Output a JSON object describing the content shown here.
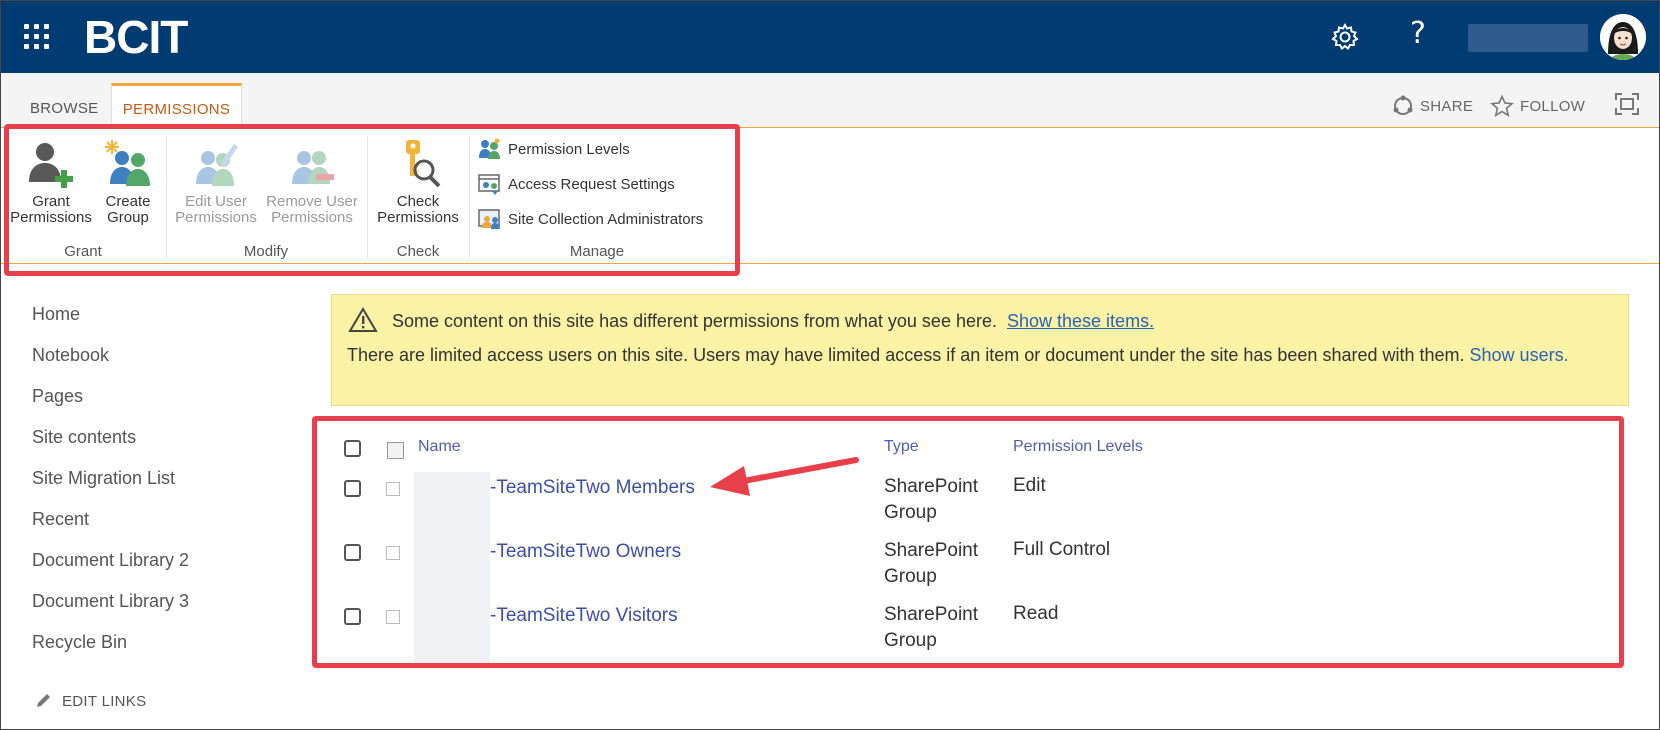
{
  "suite_bar": {
    "brand": "BCIT",
    "help_glyph": "?",
    "icons": [
      "waffle-icon",
      "gear-icon",
      "help-icon",
      "avatar"
    ]
  },
  "ribbon": {
    "tabs": [
      {
        "label": "BROWSE",
        "active": false
      },
      {
        "label": "PERMISSIONS",
        "active": true
      }
    ],
    "share_label": "SHARE",
    "follow_label": "FOLLOW",
    "groups": {
      "grant": {
        "label": "Grant",
        "buttons": [
          {
            "line1": "Grant",
            "line2": "Permissions",
            "icon": "grant-user-icon",
            "enabled": true
          },
          {
            "line1": "Create",
            "line2": "Group",
            "icon": "create-group-icon",
            "enabled": true
          }
        ]
      },
      "modify": {
        "label": "Modify",
        "buttons": [
          {
            "line1": "Edit User",
            "line2": "Permissions",
            "icon": "edit-user-icon",
            "enabled": false
          },
          {
            "line1": "Remove User",
            "line2": "Permissions",
            "icon": "remove-user-icon",
            "enabled": false
          }
        ]
      },
      "check": {
        "label": "Check",
        "buttons": [
          {
            "line1": "Check",
            "line2": "Permissions",
            "icon": "key-search-icon",
            "enabled": true
          }
        ]
      },
      "manage": {
        "label": "Manage",
        "items": [
          {
            "label": "Permission Levels",
            "icon": "permission-levels-icon"
          },
          {
            "label": "Access Request Settings",
            "icon": "access-request-icon"
          },
          {
            "label": "Site Collection Administrators",
            "icon": "site-admins-icon"
          }
        ]
      }
    }
  },
  "leftnav": {
    "items": [
      "Home",
      "Notebook",
      "Pages",
      "Site contents",
      "Site Migration List",
      "Recent",
      "Document Library 2",
      "Document Library 3",
      "Recycle Bin"
    ],
    "edit_links": "EDIT LINKS"
  },
  "banner": {
    "line1_text": "Some content on this site has different permissions from what you see here.",
    "line1_link": "Show these items.",
    "line2_text": "There are limited access users on this site. Users may have limited access if an item or document under the site has been shared with them.",
    "line2_link": "Show users."
  },
  "table": {
    "headers": {
      "name": "Name",
      "type": "Type",
      "permission": "Permission Levels"
    },
    "rows": [
      {
        "name": "-TeamSiteTwo Members",
        "type_line1": "SharePoint",
        "type_line2": "Group",
        "permission": "Edit"
      },
      {
        "name": "-TeamSiteTwo Owners",
        "type_line1": "SharePoint",
        "type_line2": "Group",
        "permission": "Full Control"
      },
      {
        "name": "-TeamSiteTwo Visitors",
        "type_line1": "SharePoint",
        "type_line2": "Group",
        "permission": "Read"
      }
    ]
  },
  "colors": {
    "suite_bar": "#003b71",
    "accent_orange": "#f0a63d",
    "highlight_red": "#e8404a",
    "link_blue": "#3b4ea8",
    "banner_yellow": "#faf2a4"
  }
}
